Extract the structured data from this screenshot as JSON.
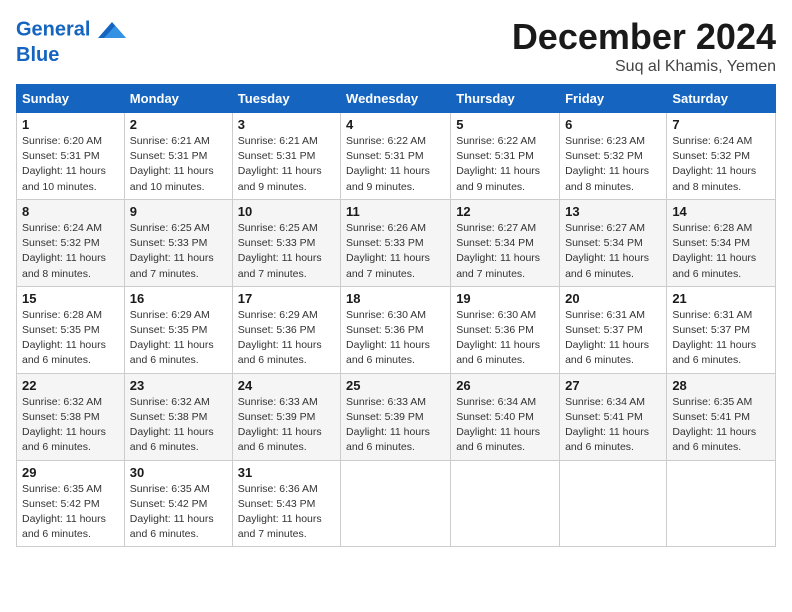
{
  "header": {
    "logo_line1": "General",
    "logo_line2": "Blue",
    "month": "December 2024",
    "location": "Suq al Khamis, Yemen"
  },
  "weekdays": [
    "Sunday",
    "Monday",
    "Tuesday",
    "Wednesday",
    "Thursday",
    "Friday",
    "Saturday"
  ],
  "weeks": [
    [
      {
        "day": "1",
        "rise": "6:20 AM",
        "set": "5:31 PM",
        "daylight": "11 hours and 10 minutes."
      },
      {
        "day": "2",
        "rise": "6:21 AM",
        "set": "5:31 PM",
        "daylight": "11 hours and 10 minutes."
      },
      {
        "day": "3",
        "rise": "6:21 AM",
        "set": "5:31 PM",
        "daylight": "11 hours and 9 minutes."
      },
      {
        "day": "4",
        "rise": "6:22 AM",
        "set": "5:31 PM",
        "daylight": "11 hours and 9 minutes."
      },
      {
        "day": "5",
        "rise": "6:22 AM",
        "set": "5:31 PM",
        "daylight": "11 hours and 9 minutes."
      },
      {
        "day": "6",
        "rise": "6:23 AM",
        "set": "5:32 PM",
        "daylight": "11 hours and 8 minutes."
      },
      {
        "day": "7",
        "rise": "6:24 AM",
        "set": "5:32 PM",
        "daylight": "11 hours and 8 minutes."
      }
    ],
    [
      {
        "day": "8",
        "rise": "6:24 AM",
        "set": "5:32 PM",
        "daylight": "11 hours and 8 minutes."
      },
      {
        "day": "9",
        "rise": "6:25 AM",
        "set": "5:33 PM",
        "daylight": "11 hours and 7 minutes."
      },
      {
        "day": "10",
        "rise": "6:25 AM",
        "set": "5:33 PM",
        "daylight": "11 hours and 7 minutes."
      },
      {
        "day": "11",
        "rise": "6:26 AM",
        "set": "5:33 PM",
        "daylight": "11 hours and 7 minutes."
      },
      {
        "day": "12",
        "rise": "6:27 AM",
        "set": "5:34 PM",
        "daylight": "11 hours and 7 minutes."
      },
      {
        "day": "13",
        "rise": "6:27 AM",
        "set": "5:34 PM",
        "daylight": "11 hours and 6 minutes."
      },
      {
        "day": "14",
        "rise": "6:28 AM",
        "set": "5:34 PM",
        "daylight": "11 hours and 6 minutes."
      }
    ],
    [
      {
        "day": "15",
        "rise": "6:28 AM",
        "set": "5:35 PM",
        "daylight": "11 hours and 6 minutes."
      },
      {
        "day": "16",
        "rise": "6:29 AM",
        "set": "5:35 PM",
        "daylight": "11 hours and 6 minutes."
      },
      {
        "day": "17",
        "rise": "6:29 AM",
        "set": "5:36 PM",
        "daylight": "11 hours and 6 minutes."
      },
      {
        "day": "18",
        "rise": "6:30 AM",
        "set": "5:36 PM",
        "daylight": "11 hours and 6 minutes."
      },
      {
        "day": "19",
        "rise": "6:30 AM",
        "set": "5:36 PM",
        "daylight": "11 hours and 6 minutes."
      },
      {
        "day": "20",
        "rise": "6:31 AM",
        "set": "5:37 PM",
        "daylight": "11 hours and 6 minutes."
      },
      {
        "day": "21",
        "rise": "6:31 AM",
        "set": "5:37 PM",
        "daylight": "11 hours and 6 minutes."
      }
    ],
    [
      {
        "day": "22",
        "rise": "6:32 AM",
        "set": "5:38 PM",
        "daylight": "11 hours and 6 minutes."
      },
      {
        "day": "23",
        "rise": "6:32 AM",
        "set": "5:38 PM",
        "daylight": "11 hours and 6 minutes."
      },
      {
        "day": "24",
        "rise": "6:33 AM",
        "set": "5:39 PM",
        "daylight": "11 hours and 6 minutes."
      },
      {
        "day": "25",
        "rise": "6:33 AM",
        "set": "5:39 PM",
        "daylight": "11 hours and 6 minutes."
      },
      {
        "day": "26",
        "rise": "6:34 AM",
        "set": "5:40 PM",
        "daylight": "11 hours and 6 minutes."
      },
      {
        "day": "27",
        "rise": "6:34 AM",
        "set": "5:41 PM",
        "daylight": "11 hours and 6 minutes."
      },
      {
        "day": "28",
        "rise": "6:35 AM",
        "set": "5:41 PM",
        "daylight": "11 hours and 6 minutes."
      }
    ],
    [
      {
        "day": "29",
        "rise": "6:35 AM",
        "set": "5:42 PM",
        "daylight": "11 hours and 6 minutes."
      },
      {
        "day": "30",
        "rise": "6:35 AM",
        "set": "5:42 PM",
        "daylight": "11 hours and 6 minutes."
      },
      {
        "day": "31",
        "rise": "6:36 AM",
        "set": "5:43 PM",
        "daylight": "11 hours and 7 minutes."
      },
      null,
      null,
      null,
      null
    ]
  ]
}
